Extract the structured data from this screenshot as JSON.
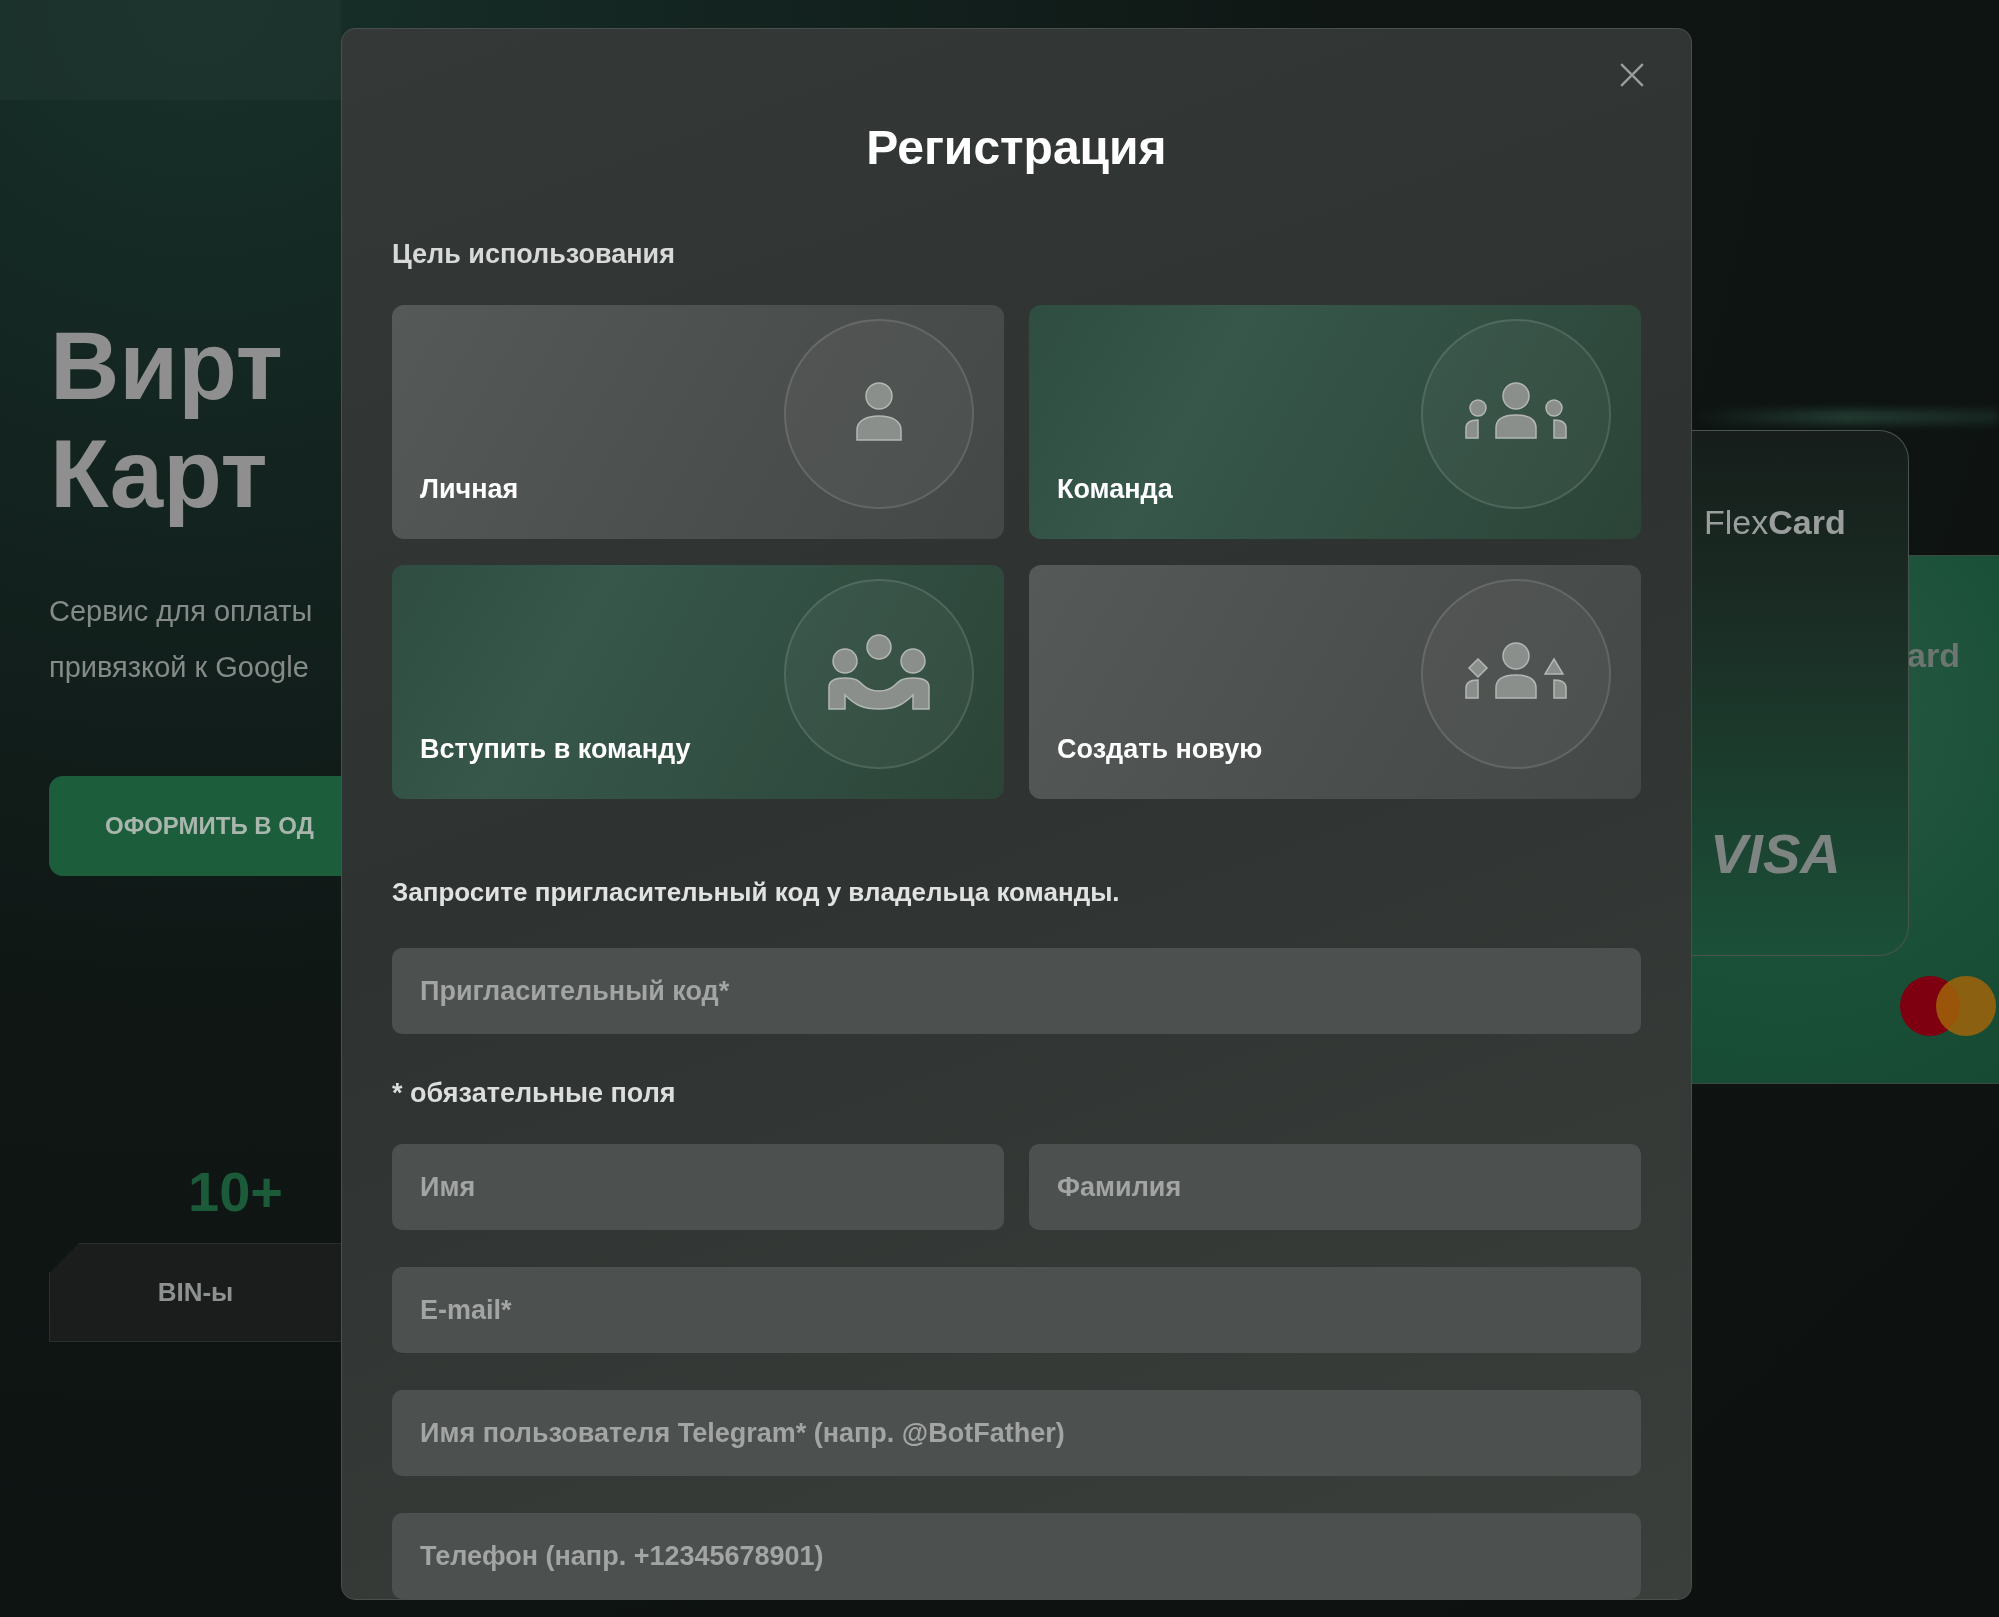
{
  "background": {
    "hero_title": [
      "Вирт",
      "Карт"
    ],
    "hero_text": [
      "Сервис для оплаты",
      "привязкой к Google"
    ],
    "cta_button": "ОФОРМИТЬ В ОД",
    "stat_value": "10+",
    "stat_label": "BIN-ы",
    "card_brand": "Flex**Card**",
    "card_fragment": "ard",
    "card_network": "VISA"
  },
  "modal": {
    "title": "Регистрация",
    "purpose_label": "Цель использования",
    "purpose_options": [
      {
        "label": "Личная",
        "kind": "person",
        "selected": false
      },
      {
        "label": "Команда",
        "kind": "group",
        "selected": true
      }
    ],
    "team_options": [
      {
        "label": "Вступить в команду",
        "kind": "join",
        "selected": true
      },
      {
        "label": "Создать новую",
        "kind": "create",
        "selected": false
      }
    ],
    "hint": "Запросите пригласительный код у владельца команды.",
    "invite_field": {
      "placeholder": "Пригласительный код*"
    },
    "required_note": "* обязательные поля",
    "name_fields": [
      {
        "placeholder": "Имя"
      },
      {
        "placeholder": "Фамилия"
      }
    ],
    "fields": [
      {
        "placeholder": "E-mail*"
      },
      {
        "placeholder": "Имя пользователя Telegram* (напр. @BotFather)"
      },
      {
        "placeholder": "Телефон (напр. +12345678901)"
      }
    ]
  }
}
